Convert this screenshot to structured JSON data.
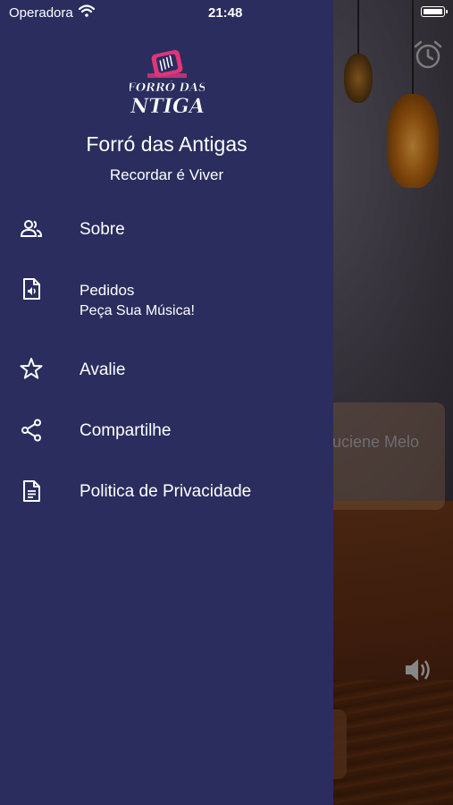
{
  "status_bar": {
    "carrier": "Operadora",
    "time": "21:48",
    "battery_level": 1.0
  },
  "drawer": {
    "title": "Forró das Antigas",
    "subtitle": "Recordar é Viver",
    "logo_text": [
      "FORRÓ DAS",
      "ANTIGAS"
    ],
    "items": [
      {
        "label": "Sobre",
        "icon": "people-icon"
      },
      {
        "label": "Pedidos",
        "sublabel": "Peça Sua Música!",
        "icon": "audio-file-icon"
      },
      {
        "label": "Avalie",
        "icon": "star-icon"
      },
      {
        "label": "Compartilhe",
        "icon": "share-icon"
      },
      {
        "label": "Politica de Privacidade",
        "icon": "document-icon"
      }
    ]
  },
  "background": {
    "card_text": "uciene Melo"
  },
  "colors": {
    "drawer_bg": "#2a2d5e",
    "text": "#ffffff",
    "logo_pink": "#e0357a"
  }
}
